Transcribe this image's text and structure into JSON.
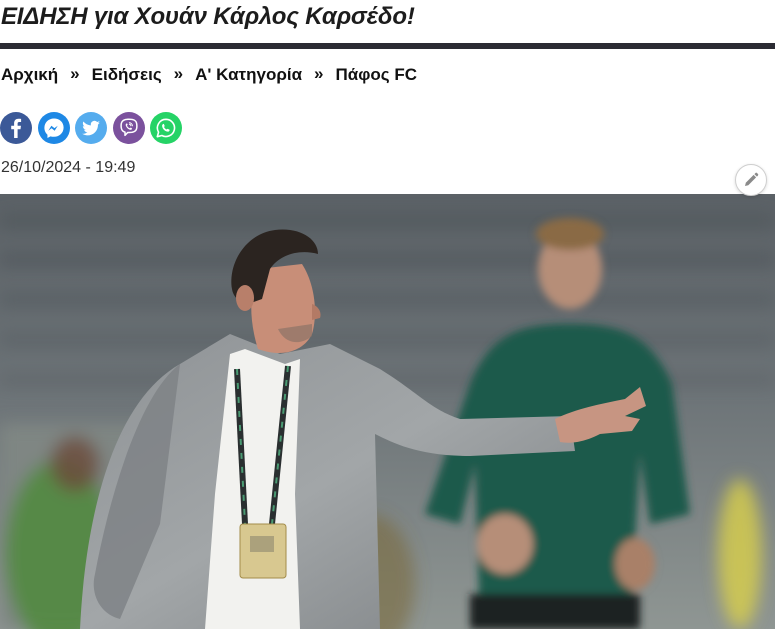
{
  "article": {
    "title": "ΕΙΔΗΣΗ για Χουάν Κάρλος Καρσέδο!",
    "date": "26/10/2024 - 19:49"
  },
  "breadcrumb": {
    "items": [
      {
        "label": "Αρχική"
      },
      {
        "label": "Ειδήσεις"
      },
      {
        "label": "Α' Κατηγορία"
      },
      {
        "label": "Πάφος FC"
      }
    ],
    "separator": "»"
  },
  "share": {
    "buttons": [
      {
        "icon": "facebook-icon",
        "color": "#3b5998"
      },
      {
        "icon": "messenger-icon",
        "color": "#1e88e5"
      },
      {
        "icon": "twitter-icon",
        "color": "#55acee"
      },
      {
        "icon": "viber-icon",
        "color": "#7b519d"
      },
      {
        "icon": "whatsapp-icon",
        "color": "#25d366"
      }
    ]
  },
  "edit": {
    "icon": "pencil-icon"
  },
  "photo": {
    "subject": "coach-gesturing-photo"
  }
}
